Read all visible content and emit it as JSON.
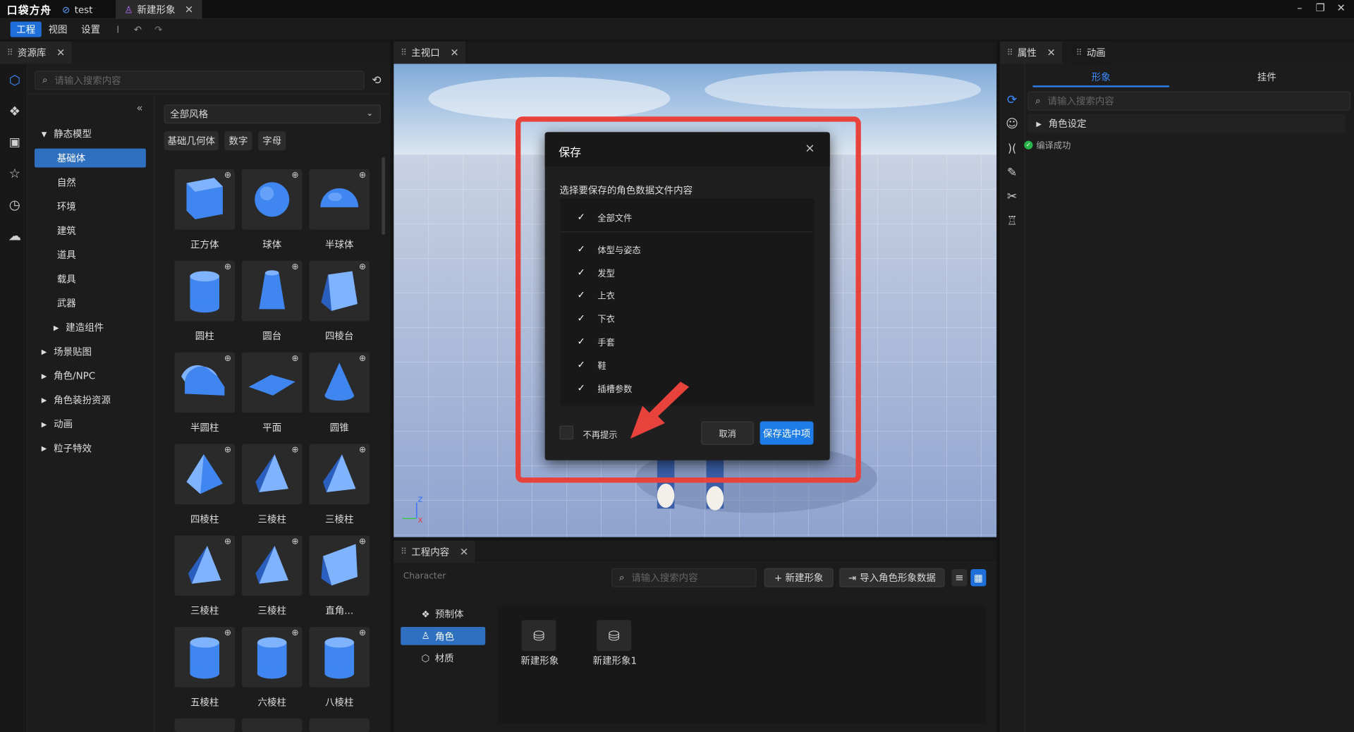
{
  "app": {
    "logo": "口袋方舟",
    "tabs": [
      {
        "label": "test"
      },
      {
        "label": "新建形象"
      }
    ],
    "window_controls": {
      "minimize": "–",
      "restore": "❐",
      "close": "✕"
    }
  },
  "menu": {
    "items": [
      "工程",
      "视图",
      "设置"
    ],
    "separator": "I"
  },
  "library": {
    "tab_title": "资源库",
    "search_placeholder": "请输入搜索内容",
    "collapse": "«",
    "style_select": "全部风格",
    "chips": [
      "基础几何体",
      "数字",
      "字母"
    ],
    "tree": [
      {
        "label": "静态模型",
        "arrow": "▼"
      },
      {
        "label": "基础体"
      },
      {
        "label": "自然"
      },
      {
        "label": "环境"
      },
      {
        "label": "建筑"
      },
      {
        "label": "道具"
      },
      {
        "label": "载具"
      },
      {
        "label": "武器"
      },
      {
        "label": "建造组件",
        "arrow": "▶"
      },
      {
        "label": "场景贴图",
        "arrow": "▶"
      },
      {
        "label": "角色/NPC",
        "arrow": "▶"
      },
      {
        "label": "角色装扮资源",
        "arrow": "▶"
      },
      {
        "label": "动画",
        "arrow": "▶"
      },
      {
        "label": "粒子特效",
        "arrow": "▶"
      }
    ],
    "assets": [
      "正方体",
      "球体",
      "半球体",
      "圆柱",
      "圆台",
      "四棱台",
      "半圆柱",
      "平面",
      "圆锥",
      "四棱柱",
      "三棱柱",
      "三棱柱",
      "三棱柱",
      "三棱柱",
      "直角...",
      "五棱柱",
      "六棱柱",
      "八棱柱"
    ]
  },
  "viewport": {
    "tab_title": "主视口",
    "axis_z": "Z",
    "axis_x": "X"
  },
  "dialog": {
    "title": "保存",
    "subtitle": "选择要保存的角色数据文件内容",
    "all_label": "全部文件",
    "items": [
      "体型与姿态",
      "发型",
      "上衣",
      "下衣",
      "手套",
      "鞋",
      "插槽参数"
    ],
    "dont_remind": "不再提示",
    "cancel": "取消",
    "confirm": "保存选中项",
    "close": "×"
  },
  "project": {
    "tab_title": "工程内容",
    "path": "Character",
    "search_placeholder": "请输入搜索内容",
    "new_button": "+ 新建形象",
    "import_button": "导入角色形象数据",
    "categories": [
      {
        "label": "预制体"
      },
      {
        "label": "角色"
      },
      {
        "label": "材质"
      }
    ],
    "items": [
      "新建形象",
      "新建形象1"
    ]
  },
  "properties": {
    "tab_title": "属性",
    "tab2_title": "动画",
    "subtabs": [
      "形象",
      "挂件"
    ],
    "search_placeholder": "请输入搜索内容",
    "tree_item": "角色设定",
    "status": "编译成功"
  },
  "colors": {
    "accent": "#1e6fd9",
    "highlight_border": "#e8423c",
    "sky": "#aecbe8",
    "floor": "#9fb2d8"
  }
}
